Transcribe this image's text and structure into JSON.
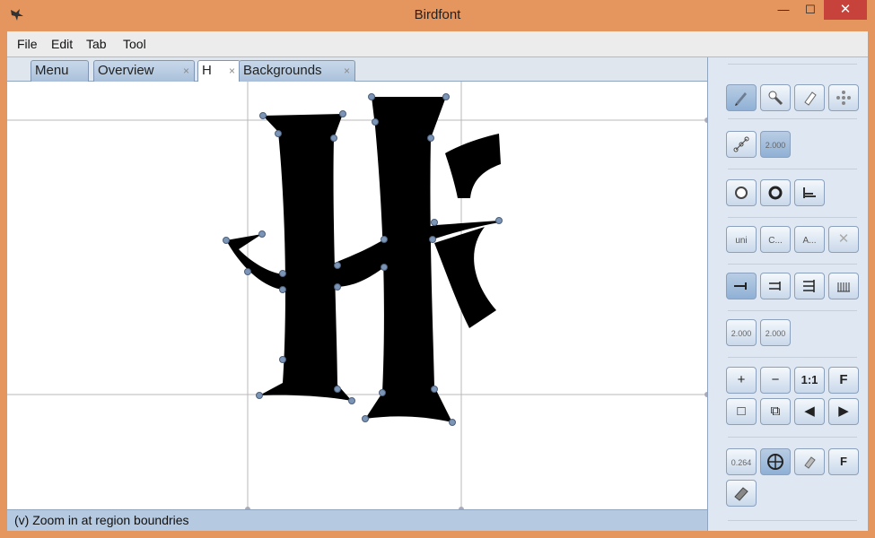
{
  "window": {
    "title": "Birdfont",
    "app_icon": "birdfont-bird-icon",
    "controls": {
      "minimize": "—",
      "maximize": "☐",
      "close": "✕"
    }
  },
  "menu": {
    "items": [
      {
        "label": "File",
        "icon": ""
      },
      {
        "label": "Edit",
        "icon": ""
      },
      {
        "label": "Tab",
        "icon": ""
      },
      {
        "label": "Tool",
        "icon": ""
      }
    ]
  },
  "tabs": [
    {
      "label": "Menu",
      "closable": false
    },
    {
      "label": "Overview",
      "close": "×"
    },
    {
      "label": "H",
      "close": "×",
      "active": true
    },
    {
      "label": "Backgrounds",
      "close": "×"
    }
  ],
  "status": {
    "text": "(v) Zoom in at region boundries"
  },
  "tools": {
    "row1": [
      "pen-icon",
      "zoom-brush-icon",
      "eraser-icon",
      "move-points-icon"
    ],
    "row2": {
      "icon": "tangent-icon",
      "value": "2.000"
    },
    "row3": [
      "circle-icon",
      "reverse-path-icon",
      "align-icon"
    ],
    "row4": [
      {
        "label": "uni",
        "icon": "unicode-icon"
      },
      {
        "label": "C...",
        "icon": "copy-icon"
      },
      {
        "label": "A...",
        "icon": "glyph-name-icon"
      },
      {
        "label": "✕",
        "icon": "close-icon"
      }
    ],
    "row5": [
      "arrow-right-line-icon",
      "double-arrow-icon",
      "triple-arrow-icon",
      "comb-icon"
    ],
    "row6": [
      "2.000",
      "2.000"
    ],
    "row7": [
      "+",
      "−",
      "1:1",
      "F"
    ],
    "row8": [
      "□",
      "⧉",
      "◀",
      "▶"
    ],
    "row9": [
      {
        "label": "0.264",
        "icon": "stroke-width-icon"
      },
      {
        "label": "",
        "icon": "move-crosshair-icon"
      },
      {
        "label": "",
        "icon": "eraser-small-icon"
      },
      {
        "label": "F",
        "icon": "font-icon"
      }
    ],
    "row10": [
      "book-icon"
    ]
  }
}
